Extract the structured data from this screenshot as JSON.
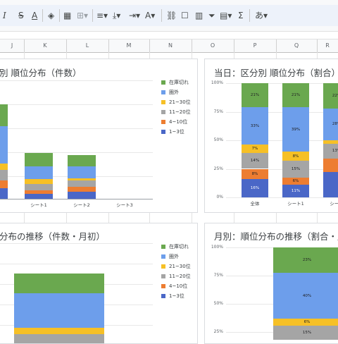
{
  "toolbar": {
    "italic": "I",
    "strikethrough": "S",
    "text_color": "A",
    "input_tools": "あ"
  },
  "columns": [
    "J",
    "K",
    "L",
    "M",
    "N",
    "O",
    "P",
    "Q",
    "R"
  ],
  "colors": {
    "in_stock_out": "#6aa84f",
    "out_of_range": "#6d9eeb",
    "r21_30": "#f6c026",
    "r11_20": "#a5a5a5",
    "r4_10": "#ed7d31",
    "r1_3": "#4a67c7"
  },
  "chart1": {
    "title": "別 順位分布（件数）",
    "legend": [
      "在庫切れ",
      "圏外",
      "21~30位",
      "11~20位",
      "4~10位",
      "1~3位"
    ],
    "chart_data": {
      "type": "bar",
      "categories": [
        "",
        "シート1",
        "シート2",
        "シート3"
      ],
      "series": [
        {
          "name": "1~3位",
          "values": [
            9,
            4,
            6,
            0
          ]
        },
        {
          "name": "4~10位",
          "values": [
            6,
            3,
            4,
            0
          ]
        },
        {
          "name": "11~20位",
          "values": [
            9,
            5,
            5,
            0
          ]
        },
        {
          "name": "21~30位",
          "values": [
            5,
            4,
            2,
            0
          ]
        },
        {
          "name": "圏外",
          "values": [
            31,
            11,
            10,
            0
          ]
        },
        {
          "name": "在庫切れ",
          "values": [
            18,
            11,
            9,
            0
          ]
        }
      ]
    }
  },
  "chart2": {
    "title": "当日：区分別 順位分布（割合）",
    "yticks": [
      "100%",
      "75%",
      "50%",
      "25%",
      "0%"
    ],
    "chart_data": {
      "type": "bar",
      "categories": [
        "全体",
        "シート1",
        "シート"
      ],
      "series": [
        {
          "name": "1~3位",
          "values": [
            16,
            11,
            22
          ]
        },
        {
          "name": "4~10位",
          "values": [
            9,
            6,
            12
          ]
        },
        {
          "name": "11~20位",
          "values": [
            14,
            15,
            13
          ]
        },
        {
          "name": "21~30位",
          "values": [
            7,
            8,
            3
          ]
        },
        {
          "name": "圏外",
          "values": [
            33,
            39,
            28
          ]
        },
        {
          "name": "在庫切れ",
          "values": [
            21,
            21,
            22
          ]
        }
      ],
      "labels": [
        [
          "16%",
          "8%",
          "14%",
          "7%",
          "33%",
          "21%"
        ],
        [
          "11%",
          "6%",
          "15%",
          "8%",
          "39%",
          "21%"
        ],
        [
          "",
          "",
          "13%",
          "",
          "28%",
          "22%"
        ]
      ]
    }
  },
  "chart3": {
    "title": "分布の推移（件数・月初）",
    "legend": [
      "在庫切れ",
      "圏外",
      "21~30位",
      "11~20位",
      "4~10位",
      "1~3位"
    ]
  },
  "chart4": {
    "title": "月別：順位分布の推移（割合・月",
    "yticks": [
      "100%",
      "75%",
      "50%",
      "25%"
    ],
    "labels": [
      "23%",
      "40%",
      "6%",
      "15%"
    ]
  }
}
